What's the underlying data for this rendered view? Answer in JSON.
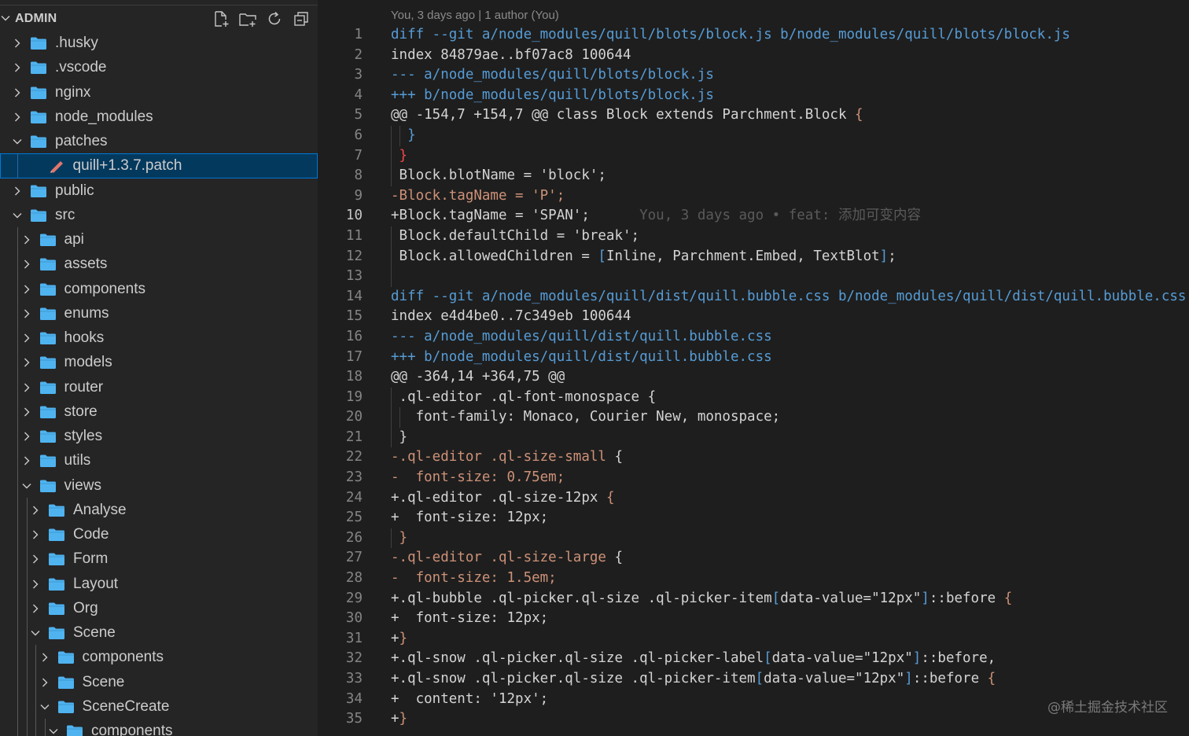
{
  "explorer": {
    "title": "ADMIN",
    "actions": [
      "new-file-icon",
      "new-folder-icon",
      "refresh-icon",
      "collapse-all-icon"
    ],
    "items": [
      {
        "label": ".husky",
        "depth": 0,
        "type": "folder",
        "expanded": false
      },
      {
        "label": ".vscode",
        "depth": 0,
        "type": "folder",
        "expanded": false
      },
      {
        "label": "nginx",
        "depth": 0,
        "type": "folder",
        "expanded": false
      },
      {
        "label": "node_modules",
        "depth": 0,
        "type": "folder",
        "expanded": false
      },
      {
        "label": "patches",
        "depth": 0,
        "type": "folder",
        "expanded": true
      },
      {
        "label": "quill+1.3.7.patch",
        "depth": 1,
        "type": "file",
        "selected": true
      },
      {
        "label": "public",
        "depth": 0,
        "type": "folder",
        "expanded": false
      },
      {
        "label": "src",
        "depth": 0,
        "type": "folder",
        "expanded": true
      },
      {
        "label": "api",
        "depth": 1,
        "type": "folder",
        "expanded": false
      },
      {
        "label": "assets",
        "depth": 1,
        "type": "folder",
        "expanded": false
      },
      {
        "label": "components",
        "depth": 1,
        "type": "folder",
        "expanded": false
      },
      {
        "label": "enums",
        "depth": 1,
        "type": "folder",
        "expanded": false
      },
      {
        "label": "hooks",
        "depth": 1,
        "type": "folder",
        "expanded": false
      },
      {
        "label": "models",
        "depth": 1,
        "type": "folder",
        "expanded": false
      },
      {
        "label": "router",
        "depth": 1,
        "type": "folder",
        "expanded": false
      },
      {
        "label": "store",
        "depth": 1,
        "type": "folder",
        "expanded": false
      },
      {
        "label": "styles",
        "depth": 1,
        "type": "folder",
        "expanded": false
      },
      {
        "label": "utils",
        "depth": 1,
        "type": "folder",
        "expanded": false
      },
      {
        "label": "views",
        "depth": 1,
        "type": "folder",
        "expanded": true
      },
      {
        "label": "Analyse",
        "depth": 2,
        "type": "folder",
        "expanded": false
      },
      {
        "label": "Code",
        "depth": 2,
        "type": "folder",
        "expanded": false
      },
      {
        "label": "Form",
        "depth": 2,
        "type": "folder",
        "expanded": false
      },
      {
        "label": "Layout",
        "depth": 2,
        "type": "folder",
        "expanded": false
      },
      {
        "label": "Org",
        "depth": 2,
        "type": "folder",
        "expanded": false
      },
      {
        "label": "Scene",
        "depth": 2,
        "type": "folder",
        "expanded": true
      },
      {
        "label": "components",
        "depth": 3,
        "type": "folder",
        "expanded": false
      },
      {
        "label": "Scene",
        "depth": 3,
        "type": "folder",
        "expanded": false
      },
      {
        "label": "SceneCreate",
        "depth": 3,
        "type": "folder",
        "expanded": true
      },
      {
        "label": "components",
        "depth": 4,
        "type": "folder",
        "expanded": true
      }
    ]
  },
  "editor": {
    "blame_header": "You, 3 days ago | 1 author (You)",
    "active_line": 10,
    "inline_blame": "You, 3 days ago • feat: 添加可变内容",
    "lines": [
      {
        "n": "1",
        "indent": 0,
        "segs": [
          [
            "diff --git a/node_modules/quill/blots/block.js b/node_modules/quill/blots/block.js",
            "meta"
          ]
        ]
      },
      {
        "n": "2",
        "indent": 0,
        "segs": [
          [
            "index 84879ae..bf07ac8 100644",
            "plain"
          ]
        ]
      },
      {
        "n": "3",
        "indent": 0,
        "segs": [
          [
            "--- a/node_modules/quill/blots/block.js",
            "meta"
          ]
        ]
      },
      {
        "n": "4",
        "indent": 0,
        "segs": [
          [
            "+++ b/node_modules/quill/blots/block.js",
            "meta"
          ]
        ]
      },
      {
        "n": "5",
        "indent": 0,
        "segs": [
          [
            "@@ -154,7 +154,7 @@ class Block extends Parchment.Block ",
            "plain"
          ],
          [
            "{",
            "brace"
          ]
        ]
      },
      {
        "n": "6",
        "indent": 2,
        "segs": [
          [
            "  ",
            "plain"
          ],
          [
            "}",
            "brace2"
          ]
        ]
      },
      {
        "n": "7",
        "indent": 1,
        "segs": [
          [
            " ",
            "plain"
          ],
          [
            "}",
            "brace-red"
          ]
        ]
      },
      {
        "n": "8",
        "indent": 1,
        "segs": [
          [
            " Block.blotName = 'block';",
            "plain"
          ]
        ]
      },
      {
        "n": "9",
        "indent": 0,
        "segs": [
          [
            "-Block.tagName = 'P';",
            "removed"
          ]
        ]
      },
      {
        "n": "10",
        "indent": 0,
        "segs": [
          [
            "+Block.tagName = 'SPAN';",
            "plain"
          ],
          [
            "      ",
            "plain"
          ]
        ],
        "blame": true
      },
      {
        "n": "11",
        "indent": 1,
        "segs": [
          [
            " Block.defaultChild = 'break';",
            "plain"
          ]
        ]
      },
      {
        "n": "12",
        "indent": 1,
        "segs": [
          [
            " Block.allowedChildren = ",
            "plain"
          ],
          [
            "[",
            "brace2"
          ],
          [
            "Inline, Parchment.Embed, TextBlot",
            "plain"
          ],
          [
            "]",
            "brace2"
          ],
          [
            ";",
            "plain"
          ]
        ]
      },
      {
        "n": "13",
        "indent": 1,
        "segs": [
          [
            "",
            "plain"
          ]
        ]
      },
      {
        "n": "14",
        "indent": 0,
        "segs": [
          [
            "diff --git a/node_modules/quill/dist/quill.bubble.css b/node_modules/quill/dist/quill.bubble.css",
            "meta"
          ]
        ]
      },
      {
        "n": "15",
        "indent": 0,
        "segs": [
          [
            "index e4d4be0..7c349eb 100644",
            "plain"
          ]
        ]
      },
      {
        "n": "16",
        "indent": 0,
        "segs": [
          [
            "--- a/node_modules/quill/dist/quill.bubble.css",
            "meta"
          ]
        ]
      },
      {
        "n": "17",
        "indent": 0,
        "segs": [
          [
            "+++ b/node_modules/quill/dist/quill.bubble.css",
            "meta"
          ]
        ]
      },
      {
        "n": "18",
        "indent": 0,
        "segs": [
          [
            "@@ -364,14 +364,75 @@",
            "plain"
          ]
        ]
      },
      {
        "n": "19",
        "indent": 1,
        "segs": [
          [
            " .ql-editor .ql-font-monospace ",
            "plain"
          ],
          [
            "{",
            "plain"
          ]
        ]
      },
      {
        "n": "20",
        "indent": 2,
        "segs": [
          [
            "   font-family: Monaco, Courier New, monospace;",
            "plain"
          ]
        ]
      },
      {
        "n": "21",
        "indent": 1,
        "segs": [
          [
            " ",
            "plain"
          ],
          [
            "}",
            "plain"
          ]
        ]
      },
      {
        "n": "22",
        "indent": 0,
        "segs": [
          [
            "-.ql-editor .ql-size-small ",
            "removed"
          ],
          [
            "{",
            "plain"
          ]
        ]
      },
      {
        "n": "23",
        "indent": 0,
        "segs": [
          [
            "-  font-size: 0.75em;",
            "removed"
          ]
        ]
      },
      {
        "n": "24",
        "indent": 0,
        "segs": [
          [
            "+.ql-editor .ql-size-12px ",
            "plain"
          ],
          [
            "{",
            "brace"
          ]
        ]
      },
      {
        "n": "25",
        "indent": 0,
        "segs": [
          [
            "+  font-size: 12px;",
            "plain"
          ]
        ]
      },
      {
        "n": "26",
        "indent": 1,
        "segs": [
          [
            " ",
            "plain"
          ],
          [
            "}",
            "brace"
          ]
        ]
      },
      {
        "n": "27",
        "indent": 0,
        "segs": [
          [
            "-.ql-editor .ql-size-large ",
            "removed"
          ],
          [
            "{",
            "plain"
          ]
        ]
      },
      {
        "n": "28",
        "indent": 0,
        "segs": [
          [
            "-  font-size: 1.5em;",
            "removed"
          ]
        ]
      },
      {
        "n": "29",
        "indent": 0,
        "segs": [
          [
            "+.ql-bubble .ql-picker.ql-size .ql-picker-item",
            "plain"
          ],
          [
            "[",
            "brace2"
          ],
          [
            "data-value=\"12px\"",
            "plain"
          ],
          [
            "]",
            "brace2"
          ],
          [
            "::before ",
            "plain"
          ],
          [
            "{",
            "brace"
          ]
        ]
      },
      {
        "n": "30",
        "indent": 0,
        "segs": [
          [
            "+  font-size: 12px;",
            "plain"
          ]
        ]
      },
      {
        "n": "31",
        "indent": 0,
        "segs": [
          [
            "+",
            "plain"
          ],
          [
            "}",
            "brace"
          ]
        ]
      },
      {
        "n": "32",
        "indent": 0,
        "segs": [
          [
            "+.ql-snow .ql-picker.ql-size .ql-picker-label",
            "plain"
          ],
          [
            "[",
            "brace2"
          ],
          [
            "data-value=\"12px\"",
            "plain"
          ],
          [
            "]",
            "brace2"
          ],
          [
            "::before,",
            "plain"
          ]
        ]
      },
      {
        "n": "33",
        "indent": 0,
        "segs": [
          [
            "+.ql-snow .ql-picker.ql-size .ql-picker-item",
            "plain"
          ],
          [
            "[",
            "brace2"
          ],
          [
            "data-value=\"12px\"",
            "plain"
          ],
          [
            "]",
            "brace2"
          ],
          [
            "::before ",
            "plain"
          ],
          [
            "{",
            "brace"
          ]
        ]
      },
      {
        "n": "34",
        "indent": 0,
        "segs": [
          [
            "+  content: '12px';",
            "plain"
          ]
        ]
      },
      {
        "n": "35",
        "indent": 0,
        "segs": [
          [
            "+",
            "plain"
          ],
          [
            "}",
            "brace"
          ]
        ]
      }
    ]
  },
  "watermark": "@稀土掘金技术社区",
  "colors": {
    "meta": "#569cd6",
    "plain": "#d4d4d4",
    "removed": "#ce9178",
    "brace": "#ce9178",
    "brace2": "#569cd6",
    "brace-red": "#f44747",
    "folder": "#4fb3f0",
    "patch": "#e0766a"
  }
}
